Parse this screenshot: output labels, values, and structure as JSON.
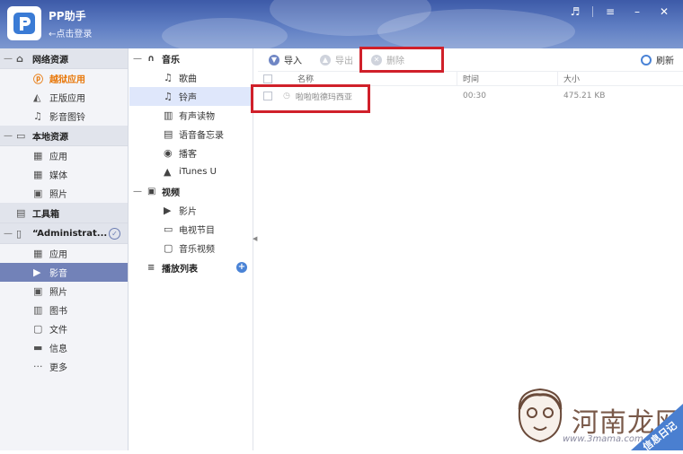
{
  "app": {
    "title": "PP助手",
    "login_link": "←点击登录",
    "controls": [
      "♬",
      "≡",
      "–",
      "✕"
    ]
  },
  "sidebar": {
    "sections": [
      {
        "title": "网络资源",
        "icon": "globe-icon",
        "items": [
          {
            "label": "越狱应用",
            "icon": "pp-logo-icon",
            "style": "orange"
          },
          {
            "label": "正版应用",
            "icon": "app-store-icon"
          },
          {
            "label": "影音图铃",
            "icon": "music-note-icon"
          }
        ]
      },
      {
        "title": "本地资源",
        "icon": "monitor-icon",
        "items": [
          {
            "label": "应用",
            "icon": "grid-icon"
          },
          {
            "label": "媒体",
            "icon": "grid-icon"
          },
          {
            "label": "照片",
            "icon": "photo-icon"
          }
        ]
      },
      {
        "title": "工具箱",
        "icon": "toolbox-icon",
        "items": []
      },
      {
        "title": "“Administrat...",
        "icon": "device-icon",
        "items": [
          {
            "label": "应用",
            "icon": "grid-icon"
          },
          {
            "label": "影音",
            "icon": "video-camera-icon",
            "selected": true
          },
          {
            "label": "照片",
            "icon": "photo-icon"
          },
          {
            "label": "图书",
            "icon": "book-icon"
          },
          {
            "label": "文件",
            "icon": "file-icon"
          },
          {
            "label": "信息",
            "icon": "message-icon"
          },
          {
            "label": "更多",
            "icon": "more-icon"
          }
        ]
      }
    ]
  },
  "media_nav": {
    "music_group": "音乐",
    "music_items": [
      "歌曲",
      "铃声",
      "有声读物",
      "语音备忘录",
      "播客",
      "iTunes U"
    ],
    "video_group": "视频",
    "video_items": [
      "影片",
      "电视节目",
      "音乐视频"
    ],
    "playlist_group": "播放列表"
  },
  "toolbar": {
    "import": "导入",
    "export": "导出",
    "delete": "删除",
    "refresh": "刷新"
  },
  "table": {
    "headers": [
      "名称",
      "时间",
      "大小"
    ],
    "rows": [
      {
        "name": "啦啦啦德玛西亚",
        "time": "00:30",
        "size": "475.21 KB"
      }
    ]
  },
  "watermark": {
    "text": "河南龙网",
    "url": "www.3mama.com",
    "corner": "信息日记"
  },
  "colors": {
    "title_bar": "#4a66b0",
    "sidebar_bg": "#f3f4f8",
    "selected": "#7282b8",
    "orange": "#e8780a",
    "highlight_red": "#d0202a"
  }
}
